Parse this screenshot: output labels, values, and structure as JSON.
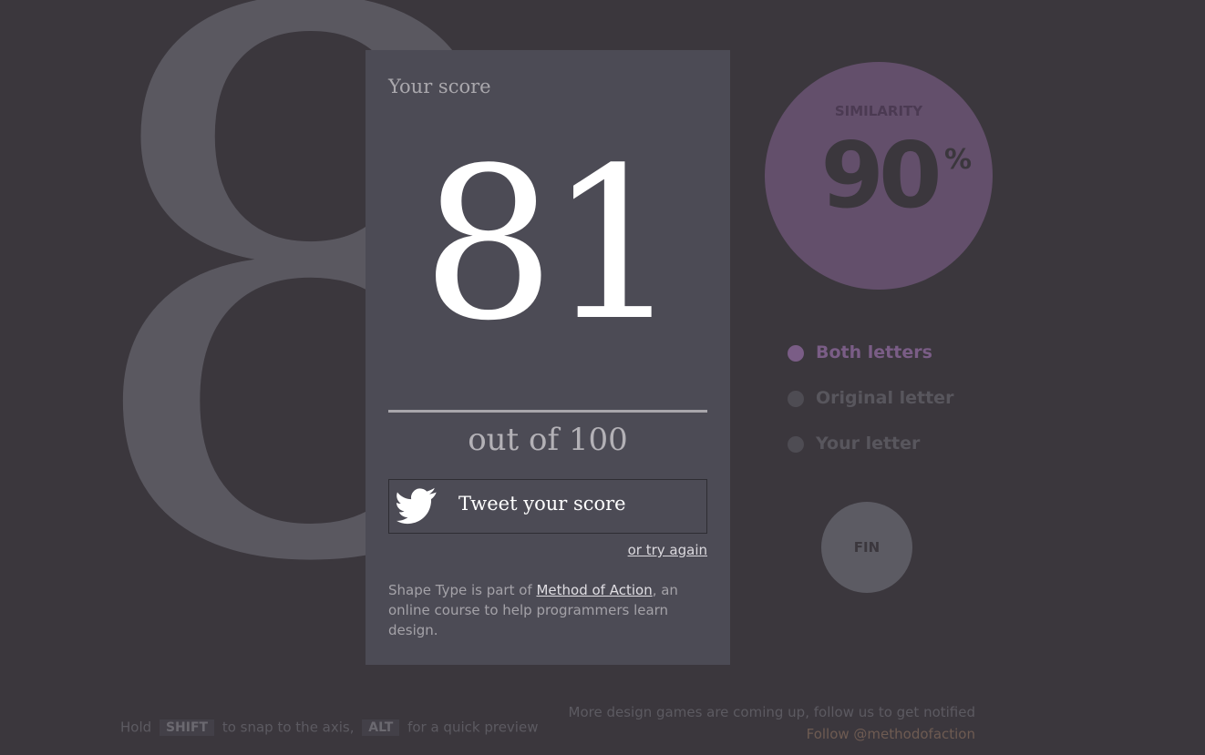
{
  "background_letter": "8",
  "score_panel": {
    "heading": "Your score",
    "score": "81",
    "out_of": "out of 100",
    "tweet_button_label": "Tweet your score",
    "try_again_label": "or try again",
    "blurb_prefix": "Shape Type is part of ",
    "blurb_link": "Method of Action",
    "blurb_suffix": ", an online course to help programmers learn design."
  },
  "similarity": {
    "label": "SIMILARITY",
    "value": "90",
    "unit": "%"
  },
  "view_options": [
    {
      "label": "Both letters",
      "selected": true
    },
    {
      "label": "Original letter",
      "selected": false
    },
    {
      "label": "Your letter",
      "selected": false
    }
  ],
  "fin_button_label": "FIN",
  "hints": {
    "hold": "Hold",
    "shift_key": "SHIFT",
    "snap_text": "to snap to the axis,",
    "alt_key": "ALT",
    "preview_text": "for a quick preview"
  },
  "follow": {
    "notice": "More design games are coming up, follow us to get notified",
    "link": "Follow @methodofaction"
  },
  "colors": {
    "background": "#3b373d",
    "panel": "#4c4b55",
    "accent_purple": "#634f6b",
    "selected_option": "#7a5d86"
  },
  "icons": {
    "tweet": "twitter-bird-icon"
  }
}
